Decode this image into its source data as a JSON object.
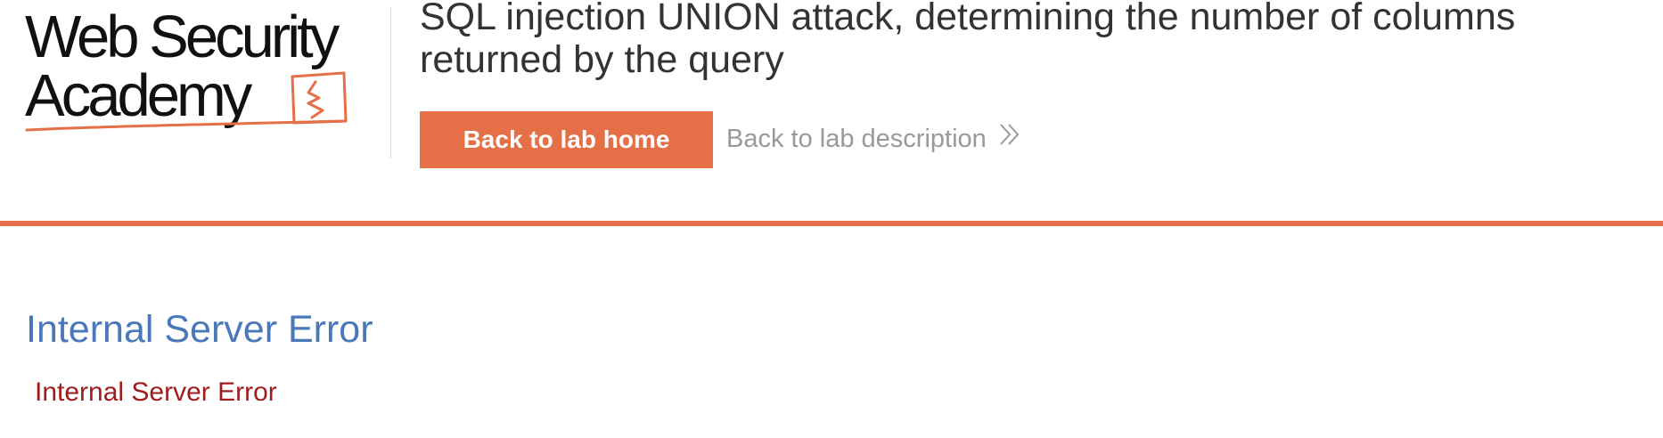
{
  "logo": {
    "line1": "Web Security",
    "line2": "Academy",
    "brand_color": "#e57047",
    "icon": "academy-logo-mark"
  },
  "header": {
    "title": "SQL injection UNION attack, determining the number of columns returned by the query",
    "back_home_label": "Back to lab home",
    "back_description_label": "Back to lab description",
    "back_description_icon": "double-chevron-right-icon",
    "accent_color": "#e57047"
  },
  "error": {
    "heading": "Internal Server Error",
    "message": "Internal Server Error",
    "heading_color": "#4a78b8",
    "message_color": "#9e1c1c"
  }
}
